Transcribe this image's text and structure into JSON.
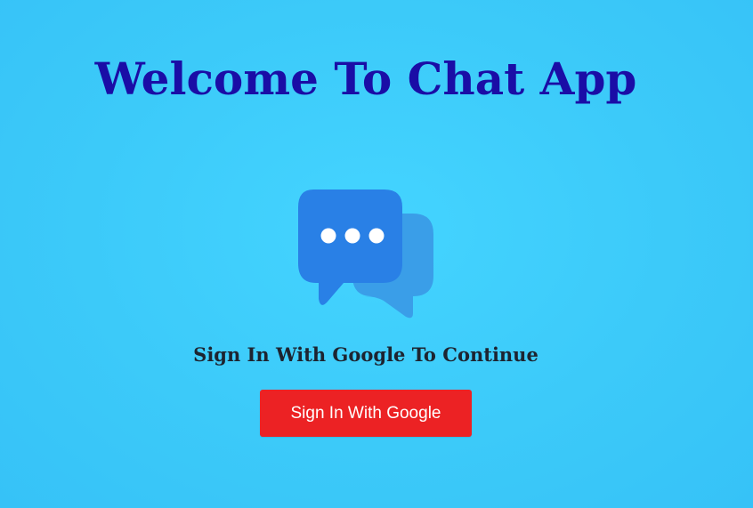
{
  "main": {
    "title": "Welcome To Chat App",
    "subtitle": "Sign In With Google To Continue",
    "sign_in_label": "Sign In With Google"
  },
  "icons": {
    "logo": "chat-bubbles-icon"
  },
  "colors": {
    "background": "#3ccaf9",
    "title": "#1a0da6",
    "subtitle": "#1d2430",
    "button": "#ec2224",
    "button_text": "#ffffff",
    "bubble_front": "#2980e6",
    "bubble_back": "#3a9ee8"
  }
}
